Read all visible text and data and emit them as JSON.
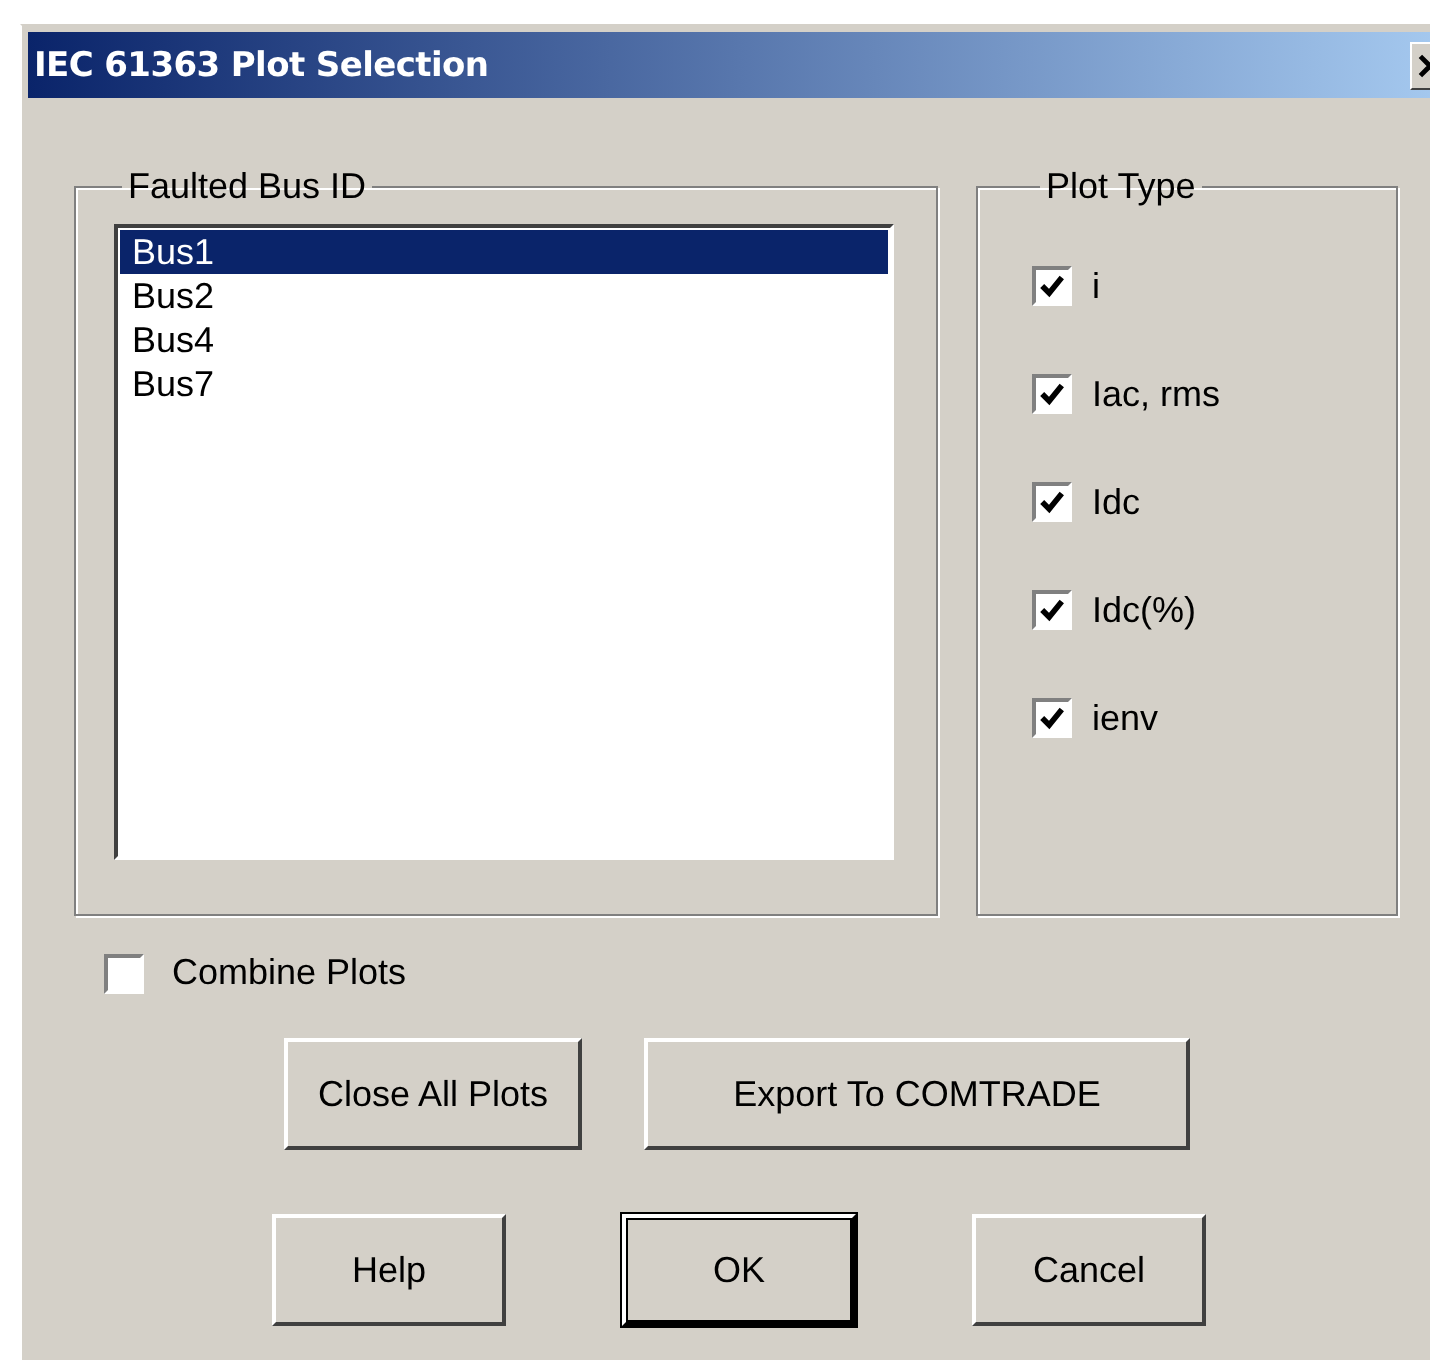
{
  "window": {
    "title": "IEC 61363 Plot Selection"
  },
  "bus_group": {
    "label": "Faulted Bus ID",
    "items": [
      {
        "label": "Bus1",
        "selected": true
      },
      {
        "label": "Bus2",
        "selected": false
      },
      {
        "label": "Bus4",
        "selected": false
      },
      {
        "label": "Bus7",
        "selected": false
      }
    ]
  },
  "plot_type_group": {
    "label": "Plot Type",
    "options": [
      {
        "label": "i",
        "checked": true
      },
      {
        "label": "Iac, rms",
        "checked": true
      },
      {
        "label": "Idc",
        "checked": true
      },
      {
        "label": "Idc(%)",
        "checked": true
      },
      {
        "label": "ienv",
        "checked": true
      }
    ]
  },
  "combine_plots": {
    "label": "Combine Plots",
    "checked": false
  },
  "action_buttons": [
    "Close All Plots",
    "Export To COMTRADE"
  ],
  "dialog_buttons": [
    {
      "label": "Help",
      "default": false
    },
    {
      "label": "OK",
      "default": true
    },
    {
      "label": "Cancel",
      "default": false
    }
  ]
}
